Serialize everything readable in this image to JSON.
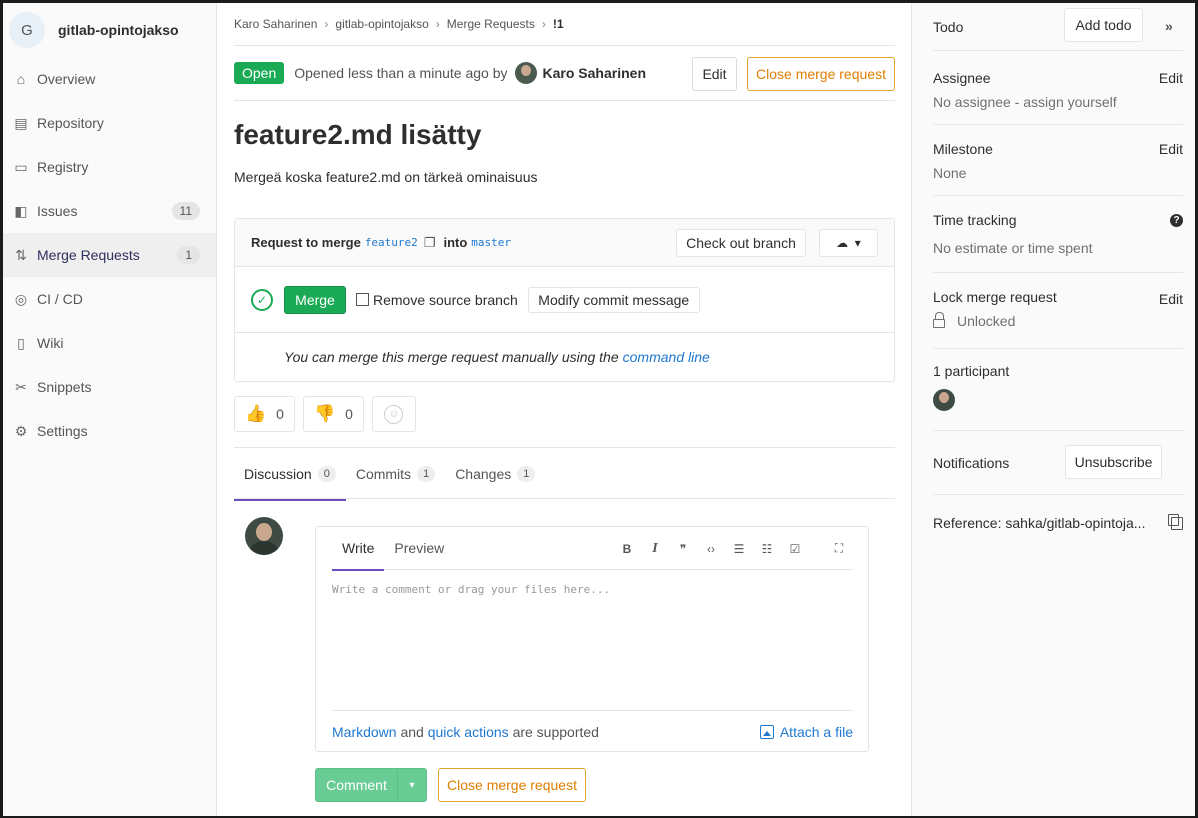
{
  "project": {
    "initial": "G",
    "name": "gitlab-opintojakso"
  },
  "nav": {
    "overview": "Overview",
    "repository": "Repository",
    "registry": "Registry",
    "issues": "Issues",
    "issues_count": "11",
    "merge_requests": "Merge Requests",
    "merge_requests_count": "1",
    "cicd": "CI / CD",
    "wiki": "Wiki",
    "snippets": "Snippets",
    "settings": "Settings"
  },
  "breadcrumb": [
    "Karo Saharinen",
    "gitlab-opintojakso",
    "Merge Requests",
    "!1"
  ],
  "mr": {
    "status": "Open",
    "opened_text": "Opened less than a minute ago by",
    "author": "Karo Saharinen",
    "edit_label": "Edit",
    "close_label": "Close merge request",
    "title": "feature2.md lisätty",
    "description": "Mergeä koska feature2.md on tärkeä ominaisuus"
  },
  "widget": {
    "request_prefix": "Request to merge",
    "source_branch": "feature2",
    "into_label": "into",
    "target_branch": "master",
    "checkout_label": "Check out branch",
    "merge_label": "Merge",
    "remove_branch_label": "Remove source branch",
    "modify_label": "Modify commit message",
    "manual_text": "You can merge this merge request manually using the",
    "command_line": "command line"
  },
  "awards": {
    "thumbsup_count": "0",
    "thumbsdown_count": "0"
  },
  "tabs": [
    {
      "label": "Discussion",
      "count": "0"
    },
    {
      "label": "Commits",
      "count": "1"
    },
    {
      "label": "Changes",
      "count": "1"
    }
  ],
  "editor": {
    "write_tab": "Write",
    "preview_tab": "Preview",
    "placeholder": "Write a comment or drag your files here...",
    "markdown": "Markdown",
    "and": "and",
    "quick_actions": "quick actions",
    "supported": "are supported",
    "attach": "Attach a file",
    "toolbar": {
      "bold": "B",
      "italic": "I",
      "quote": "❞",
      "code": "‹›",
      "ul": "☰",
      "ol": "☷",
      "task": "☑",
      "full": "⛶"
    }
  },
  "comment": {
    "comment_label": "Comment",
    "close_label": "Close merge request"
  },
  "sidebar": {
    "todo": "Todo",
    "add_todo": "Add todo",
    "assignee": "Assignee",
    "assignee_val": "No assignee - assign yourself",
    "milestone": "Milestone",
    "milestone_val": "None",
    "time_tracking": "Time tracking",
    "time_val": "No estimate or time spent",
    "lock": "Lock merge request",
    "lock_val": "Unlocked",
    "participants": "1 participant",
    "notifications": "Notifications",
    "unsubscribe": "Unsubscribe",
    "reference": "Reference: sahka/gitlab-opintoja...",
    "edit": "Edit"
  },
  "colors": {
    "green": "#1aaa55",
    "orange": "#de7e00",
    "link": "#1f78d1",
    "purple": "#6b4fbb"
  }
}
